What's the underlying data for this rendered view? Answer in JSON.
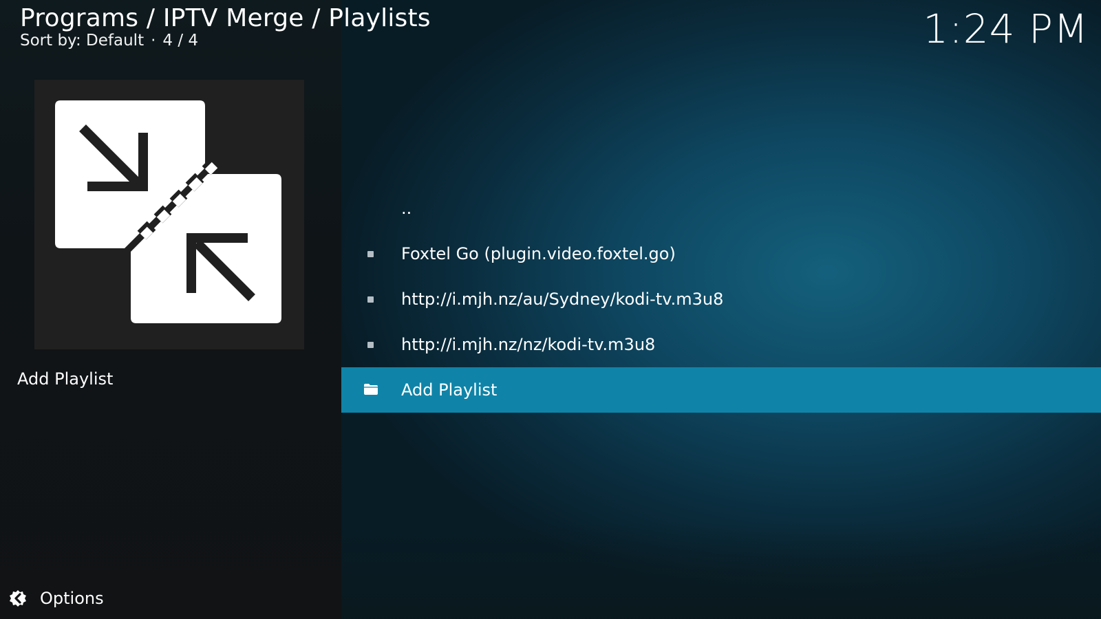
{
  "header": {
    "breadcrumb": "Programs / IPTV Merge / Playlists",
    "sort_label": "Sort by: Default",
    "position": "4 / 4",
    "clock": "1:24 PM"
  },
  "info_panel": {
    "thumbnail_icon": "merge-arrows-icon",
    "selected_title": "Add Playlist"
  },
  "list": {
    "items": [
      {
        "label": "..",
        "icon": ""
      },
      {
        "label": "Foxtel Go (plugin.video.foxtel.go)",
        "icon": "bullet"
      },
      {
        "label": "http://i.mjh.nz/au/Sydney/kodi-tv.m3u8",
        "icon": "bullet"
      },
      {
        "label": "http://i.mjh.nz/nz/kodi-tv.m3u8",
        "icon": "bullet"
      },
      {
        "label": "Add Playlist",
        "icon": "folder-icon",
        "selected": true
      }
    ]
  },
  "footer": {
    "options_label": "Options",
    "options_icon": "options-gear-icon"
  },
  "colors": {
    "selection": "#0f84a8",
    "background_left": "#101417",
    "background_right": "#0e4660"
  }
}
